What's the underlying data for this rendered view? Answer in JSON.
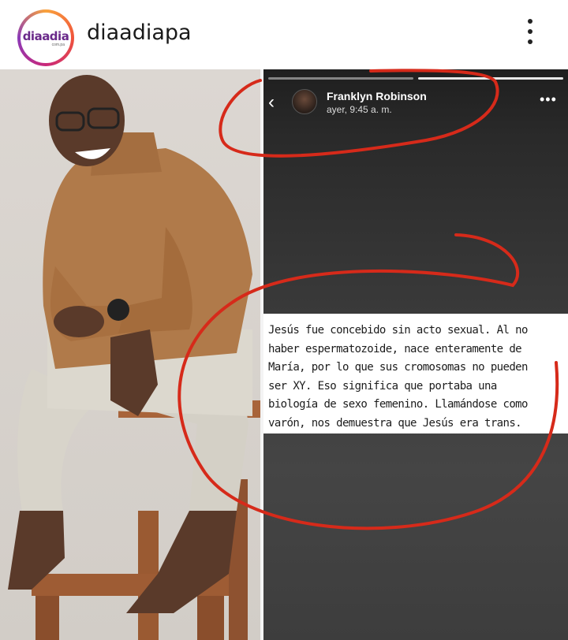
{
  "header": {
    "logo_main": "diaadia",
    "logo_sub": "com.pa",
    "username": "diaadiapa"
  },
  "story": {
    "author": "Franklyn Robinson",
    "time": "ayer, 9:45 a. m.",
    "back_glyph": "‹",
    "more_glyph": "•••",
    "text": "Jesús fue concebido sin acto sexual. Al no\nhaber espermatozoide, nace enteramente de\nMaría, por lo que sus cromosomas no pueden\nser XY. Eso significa que portaba una\nbiología de sexo femenino. Llamándose como\nvarón, nos demuestra que Jesús era trans."
  },
  "colors": {
    "annotation": "#d62a1a",
    "shirt": "#b07a4a",
    "pants": "#d8d4ca",
    "skin": "#5a3a2a",
    "stool": "#9a5a32"
  },
  "icons": {
    "menu": "more-vertical-icon",
    "back": "chevron-left-icon",
    "options": "more-horizontal-icon"
  }
}
